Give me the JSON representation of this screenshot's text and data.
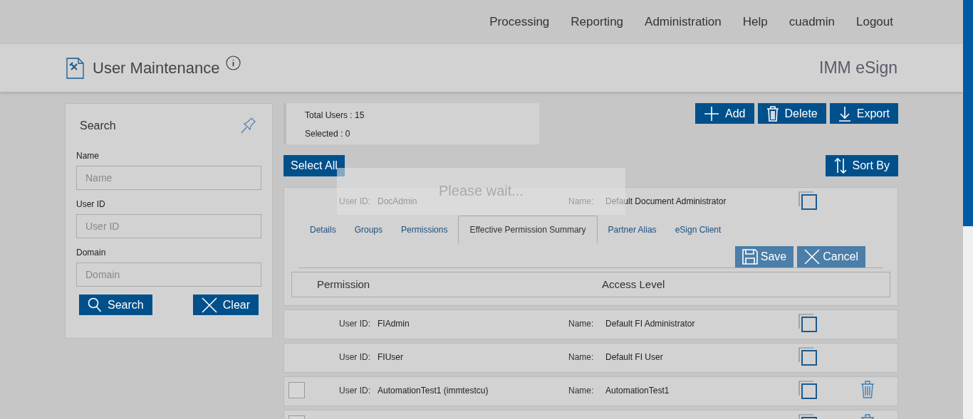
{
  "nav": [
    "Processing",
    "Reporting",
    "Administration",
    "Help",
    "cuadmin",
    "Logout"
  ],
  "header": {
    "title": "User Maintenance",
    "brand": "IMM eSign"
  },
  "search_panel": {
    "title": "Search",
    "fields": [
      {
        "label": "Name",
        "placeholder": "Name"
      },
      {
        "label": "User ID",
        "placeholder": "User ID"
      },
      {
        "label": "Domain",
        "placeholder": "Domain"
      }
    ],
    "buttons": [
      {
        "label": "Search",
        "kind": "search"
      },
      {
        "label": "Clear",
        "kind": "clear"
      }
    ]
  },
  "summary": {
    "total": "Total Users : 15",
    "selected": "Selected : 0"
  },
  "toolbar": [
    {
      "label": "Add",
      "kind": "add"
    },
    {
      "label": "Delete",
      "kind": "delete"
    },
    {
      "label": "Export",
      "kind": "export"
    }
  ],
  "select_all": "Select All",
  "sort_by": "Sort By",
  "loading": "Please wait...",
  "users": [
    {
      "id_label": "User ID:",
      "id": "DocAdmin",
      "name_label": "Name:",
      "name": "Default Document Administrator",
      "expanded": true,
      "tabs": [
        {
          "label": "Details",
          "selected": false
        },
        {
          "label": "Groups",
          "selected": false
        },
        {
          "label": "Permissions",
          "selected": false
        },
        {
          "label": "Effective Permission Summary",
          "selected": true
        },
        {
          "label": "Partner Alias",
          "selected": false
        },
        {
          "label": "eSign Client",
          "selected": false
        }
      ],
      "actions": [
        {
          "label": "Save",
          "kind": "save",
          "disabled": true
        },
        {
          "label": "Cancel",
          "kind": "cancel",
          "disabled": true
        }
      ],
      "columns": [
        "Permission",
        "Access Level"
      ]
    },
    {
      "id_label": "User ID:",
      "id": "FIAdmin",
      "name_label": "Name:",
      "name": "Default FI Administrator",
      "expanded": false
    },
    {
      "id_label": "User ID:",
      "id": "FIUser",
      "name_label": "Name:",
      "name": "Default FI User",
      "expanded": false
    },
    {
      "id_label": "User ID:",
      "id": "AutomationTest1 (immtestcu)",
      "name_label": "Name:",
      "name": "AutomationTest1",
      "expanded": false,
      "checked": false,
      "deletable": true
    },
    {
      "expanded": false,
      "checked": false,
      "deletable": true
    }
  ]
}
